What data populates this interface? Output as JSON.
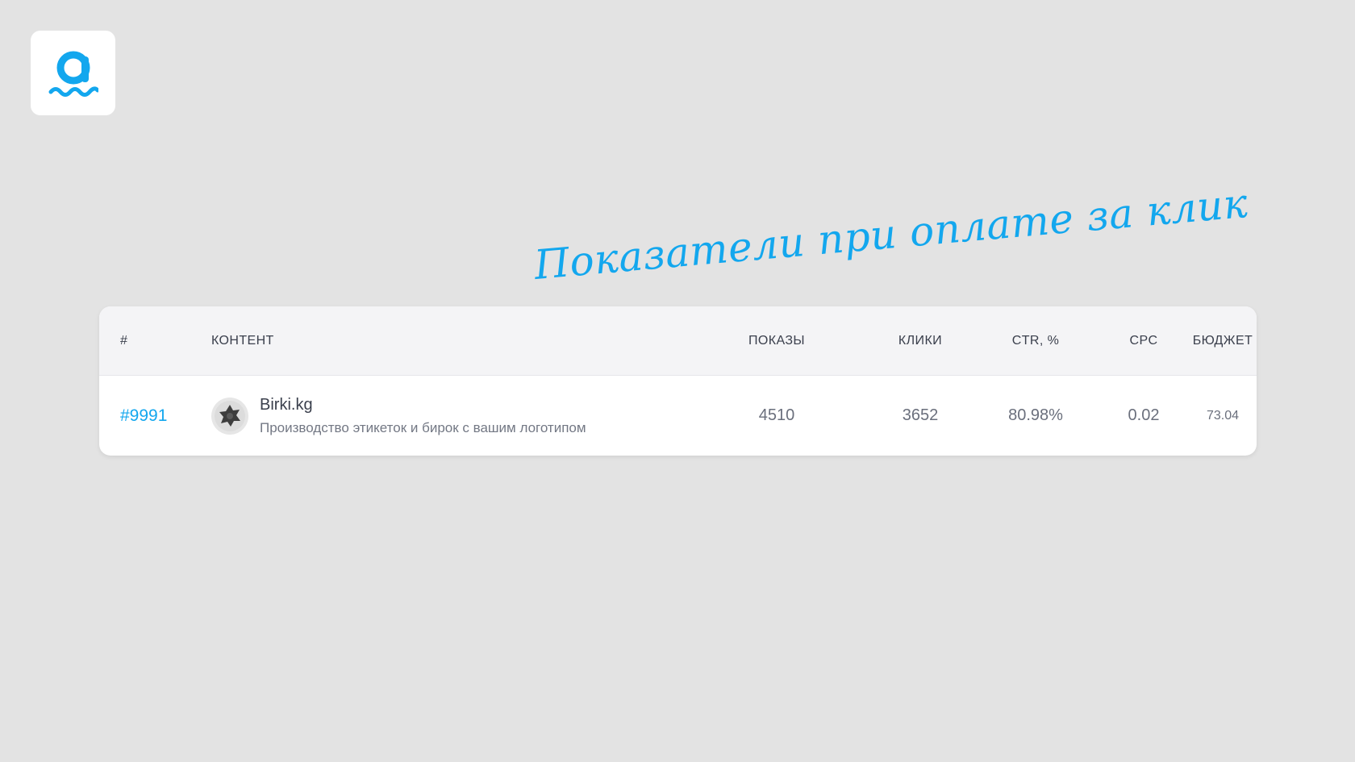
{
  "heading": "Показатели при оплате за клик",
  "logo": {
    "icon": "brand-logo-icon",
    "accent_color": "#13a7ee"
  },
  "table": {
    "headers": {
      "id": "#",
      "content": "КОНТЕНТ",
      "shows": "ПОКАЗЫ",
      "clicks": "КЛИКИ",
      "ctr": "CTR, %",
      "cpc": "CPC",
      "budget": "БЮДЖЕТ"
    },
    "rows": [
      {
        "id": "#9991",
        "avatar_icon": "birki-logo-icon",
        "title": "Birki.kg",
        "description": "Производство этикеток и бирок с вашим логотипом",
        "shows": "4510",
        "clicks": "3652",
        "ctr": "80.98%",
        "cpc": "0.02",
        "budget": "73.04"
      }
    ]
  }
}
